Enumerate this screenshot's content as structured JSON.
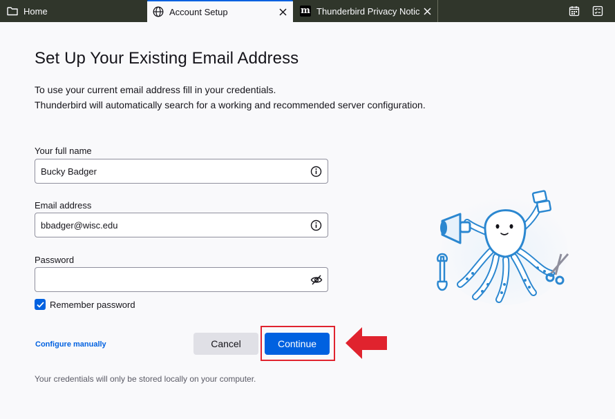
{
  "tabs": [
    {
      "label": "Home",
      "icon": "folder-icon"
    },
    {
      "label": "Account Setup",
      "icon": "globe-icon"
    },
    {
      "label": "Thunderbird Privacy Notice",
      "icon": "mozilla-m-icon"
    }
  ],
  "tabbar_tools": [
    "calendar-icon",
    "tasks-icon"
  ],
  "page": {
    "title": "Set Up Your Existing Email Address",
    "intro_line1": "To use your current email address fill in your credentials.",
    "intro_line2": "Thunderbird will automatically search for a working and recommended server configuration."
  },
  "form": {
    "name_label": "Your full name",
    "name_value": "Bucky Badger",
    "email_label": "Email address",
    "email_value": "bbadger@wisc.edu",
    "password_label": "Password",
    "password_value": "",
    "remember_label": "Remember password",
    "remember_checked": true
  },
  "actions": {
    "configure_label": "Configure manually",
    "cancel_label": "Cancel",
    "continue_label": "Continue"
  },
  "footnote": "Your credentials will only be stored locally on your computer.",
  "colors": {
    "accent": "#0061e0",
    "tabbar": "#30362b",
    "highlight": "#e0232e"
  }
}
